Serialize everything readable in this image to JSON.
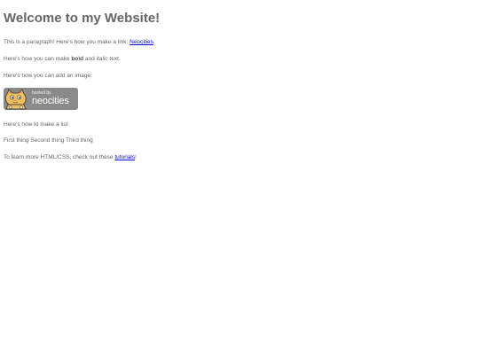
{
  "heading": "Welcome to my Website!",
  "para1": {
    "text": "This is a paragraph! Here's how you make a link: ",
    "link": "Neocities",
    "end": "."
  },
  "para2": {
    "before": "Here's how you can make ",
    "bold": "bold",
    "middle": " and ",
    "italic": "italic",
    "end": " text."
  },
  "para3": "Here's how you can add an image:",
  "image": {
    "hosted_by": "hosted by",
    "brand": "neocities",
    "icon": "neocities-cat-icon"
  },
  "para4": "Here's how to make a list:",
  "list": [
    "First thing",
    "Second thing",
    "Third thing"
  ],
  "para5": {
    "text": "To learn more HTML/CSS, check out these ",
    "link": "tutorials",
    "end": "!"
  },
  "colors": {
    "text": "#666666",
    "link": "#0000ee",
    "badge": "#8a8a8a"
  }
}
